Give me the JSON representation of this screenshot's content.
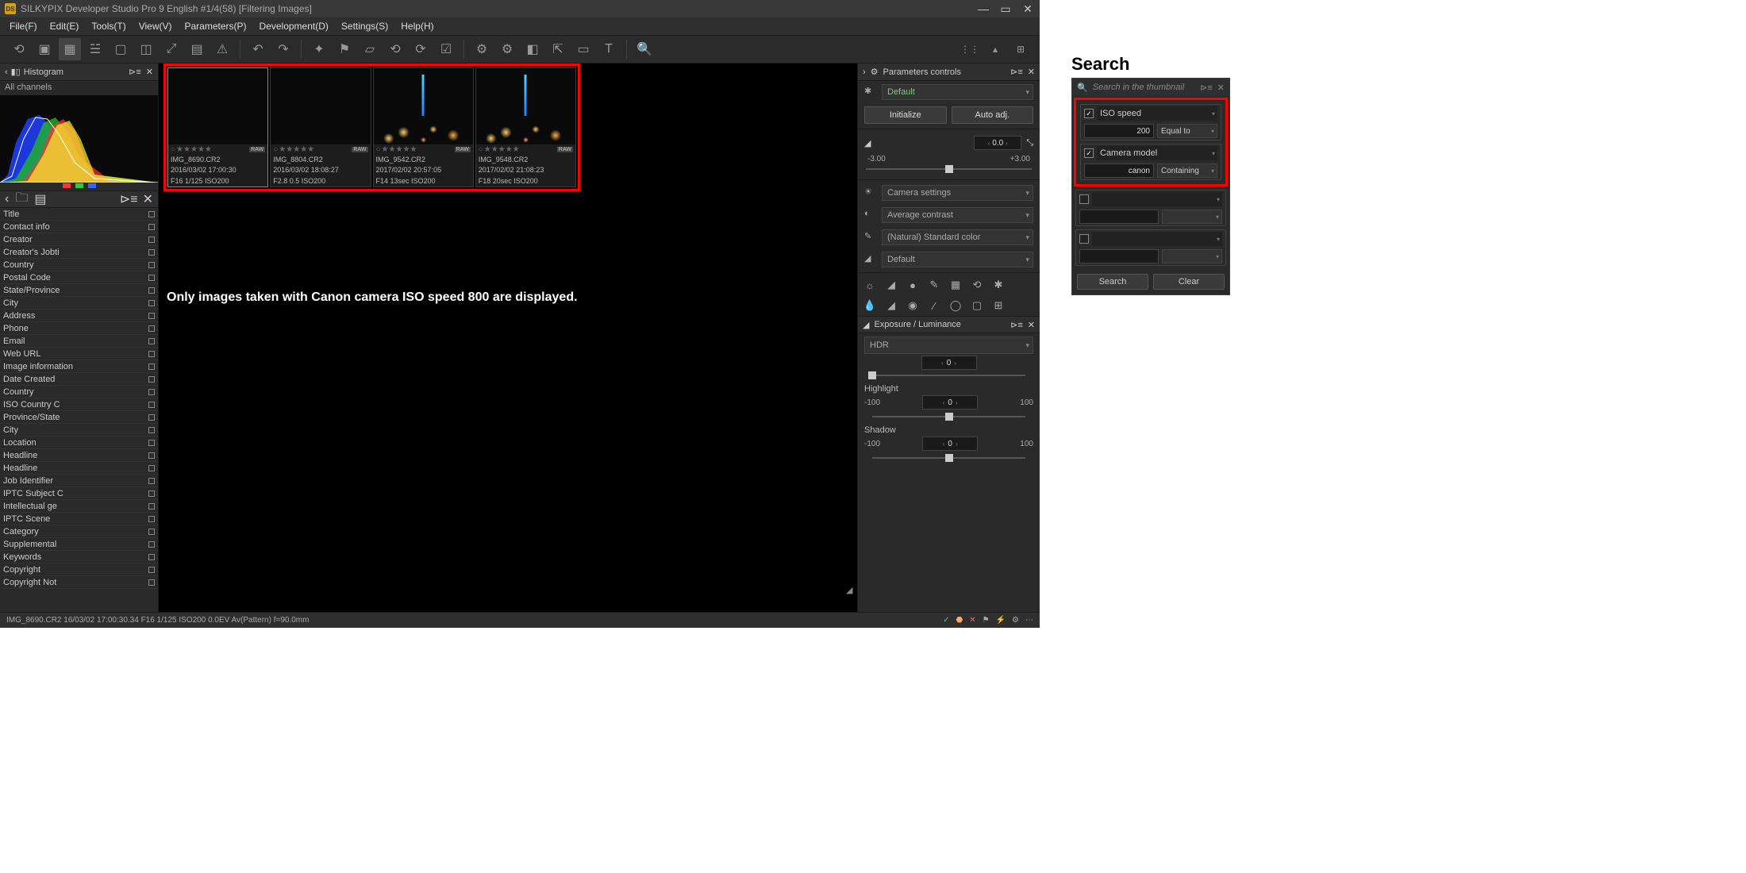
{
  "title": "SILKYPIX Developer Studio Pro 9 English   #1/4(58)  [Filtering Images]",
  "menu": [
    "File(F)",
    "Edit(E)",
    "Tools(T)",
    "View(V)",
    "Parameters(P)",
    "Development(D)",
    "Settings(S)",
    "Help(H)"
  ],
  "histogram": {
    "title": "Histogram",
    "channels": "All channels"
  },
  "meta_fields": [
    "Title",
    "Contact info",
    "Creator",
    "Creator's Jobti",
    "Country",
    "Postal Code",
    "State/Province",
    "City",
    "Address",
    "Phone",
    "Email",
    "Web URL",
    "Image information",
    "Date Created",
    "Country",
    "ISO Country C",
    "Province/State",
    "City",
    "Location",
    "Headline",
    "Headline",
    "Job Identifier",
    "IPTC Subject C",
    "Intellectual ge",
    "IPTC Scene",
    "Category",
    "Supplemental",
    "Keywords",
    "Copyright",
    "Copyright Not"
  ],
  "thumbs": [
    {
      "file": "IMG_8690.CR2",
      "date": "2016/03/02 17:00:30",
      "exp": "F16 1/125 ISO200",
      "cls": "sky1",
      "sel": true
    },
    {
      "file": "IMG_8804.CR2",
      "date": "2016/03/02 18:08:27",
      "exp": "F2.8 0.5 ISO200",
      "cls": "sky2"
    },
    {
      "file": "IMG_9542.CR2",
      "date": "2017/02/02 20:57:05",
      "exp": "F14 13sec ISO200",
      "cls": "night",
      "tower": true
    },
    {
      "file": "IMG_9548.CR2",
      "date": "2017/02/02 21:08:23",
      "exp": "F18 20sec ISO200",
      "cls": "night",
      "tower": true
    }
  ],
  "caption": "Only images taken with Canon camera ISO speed  800 are displayed.",
  "params": {
    "title": "Parameters controls",
    "preset": "Default",
    "init": "Initialize",
    "auto": "Auto adj.",
    "ev_val": "0.0",
    "ev_min": "-3.00",
    "ev_max": "+3.00",
    "wb": "Camera settings",
    "tone": "Average contrast",
    "color": "(Natural) Standard color",
    "sharp": "Default"
  },
  "exposure": {
    "title": "Exposure / Luminance",
    "hdr": "HDR",
    "hdr_val": "0",
    "hl": "Highlight",
    "hl_min": "-100",
    "hl_val": "0",
    "hl_max": "100",
    "sh": "Shadow",
    "sh_min": "-100",
    "sh_val": "0",
    "sh_max": "100"
  },
  "status": "IMG_8690.CR2 16/03/02 17:00:30.34 F16 1/125 ISO200  0.0EV Av(Pattern) f=90.0mm",
  "search": {
    "heading": "Search",
    "placeholder": "Search in the thumbnail",
    "f1_label": "ISO speed",
    "f1_val": "200",
    "f1_op": "Equal to",
    "f2_label": "Camera model",
    "f2_val": "canon",
    "f2_op": "Containing",
    "btn_search": "Search",
    "btn_clear": "Clear"
  }
}
